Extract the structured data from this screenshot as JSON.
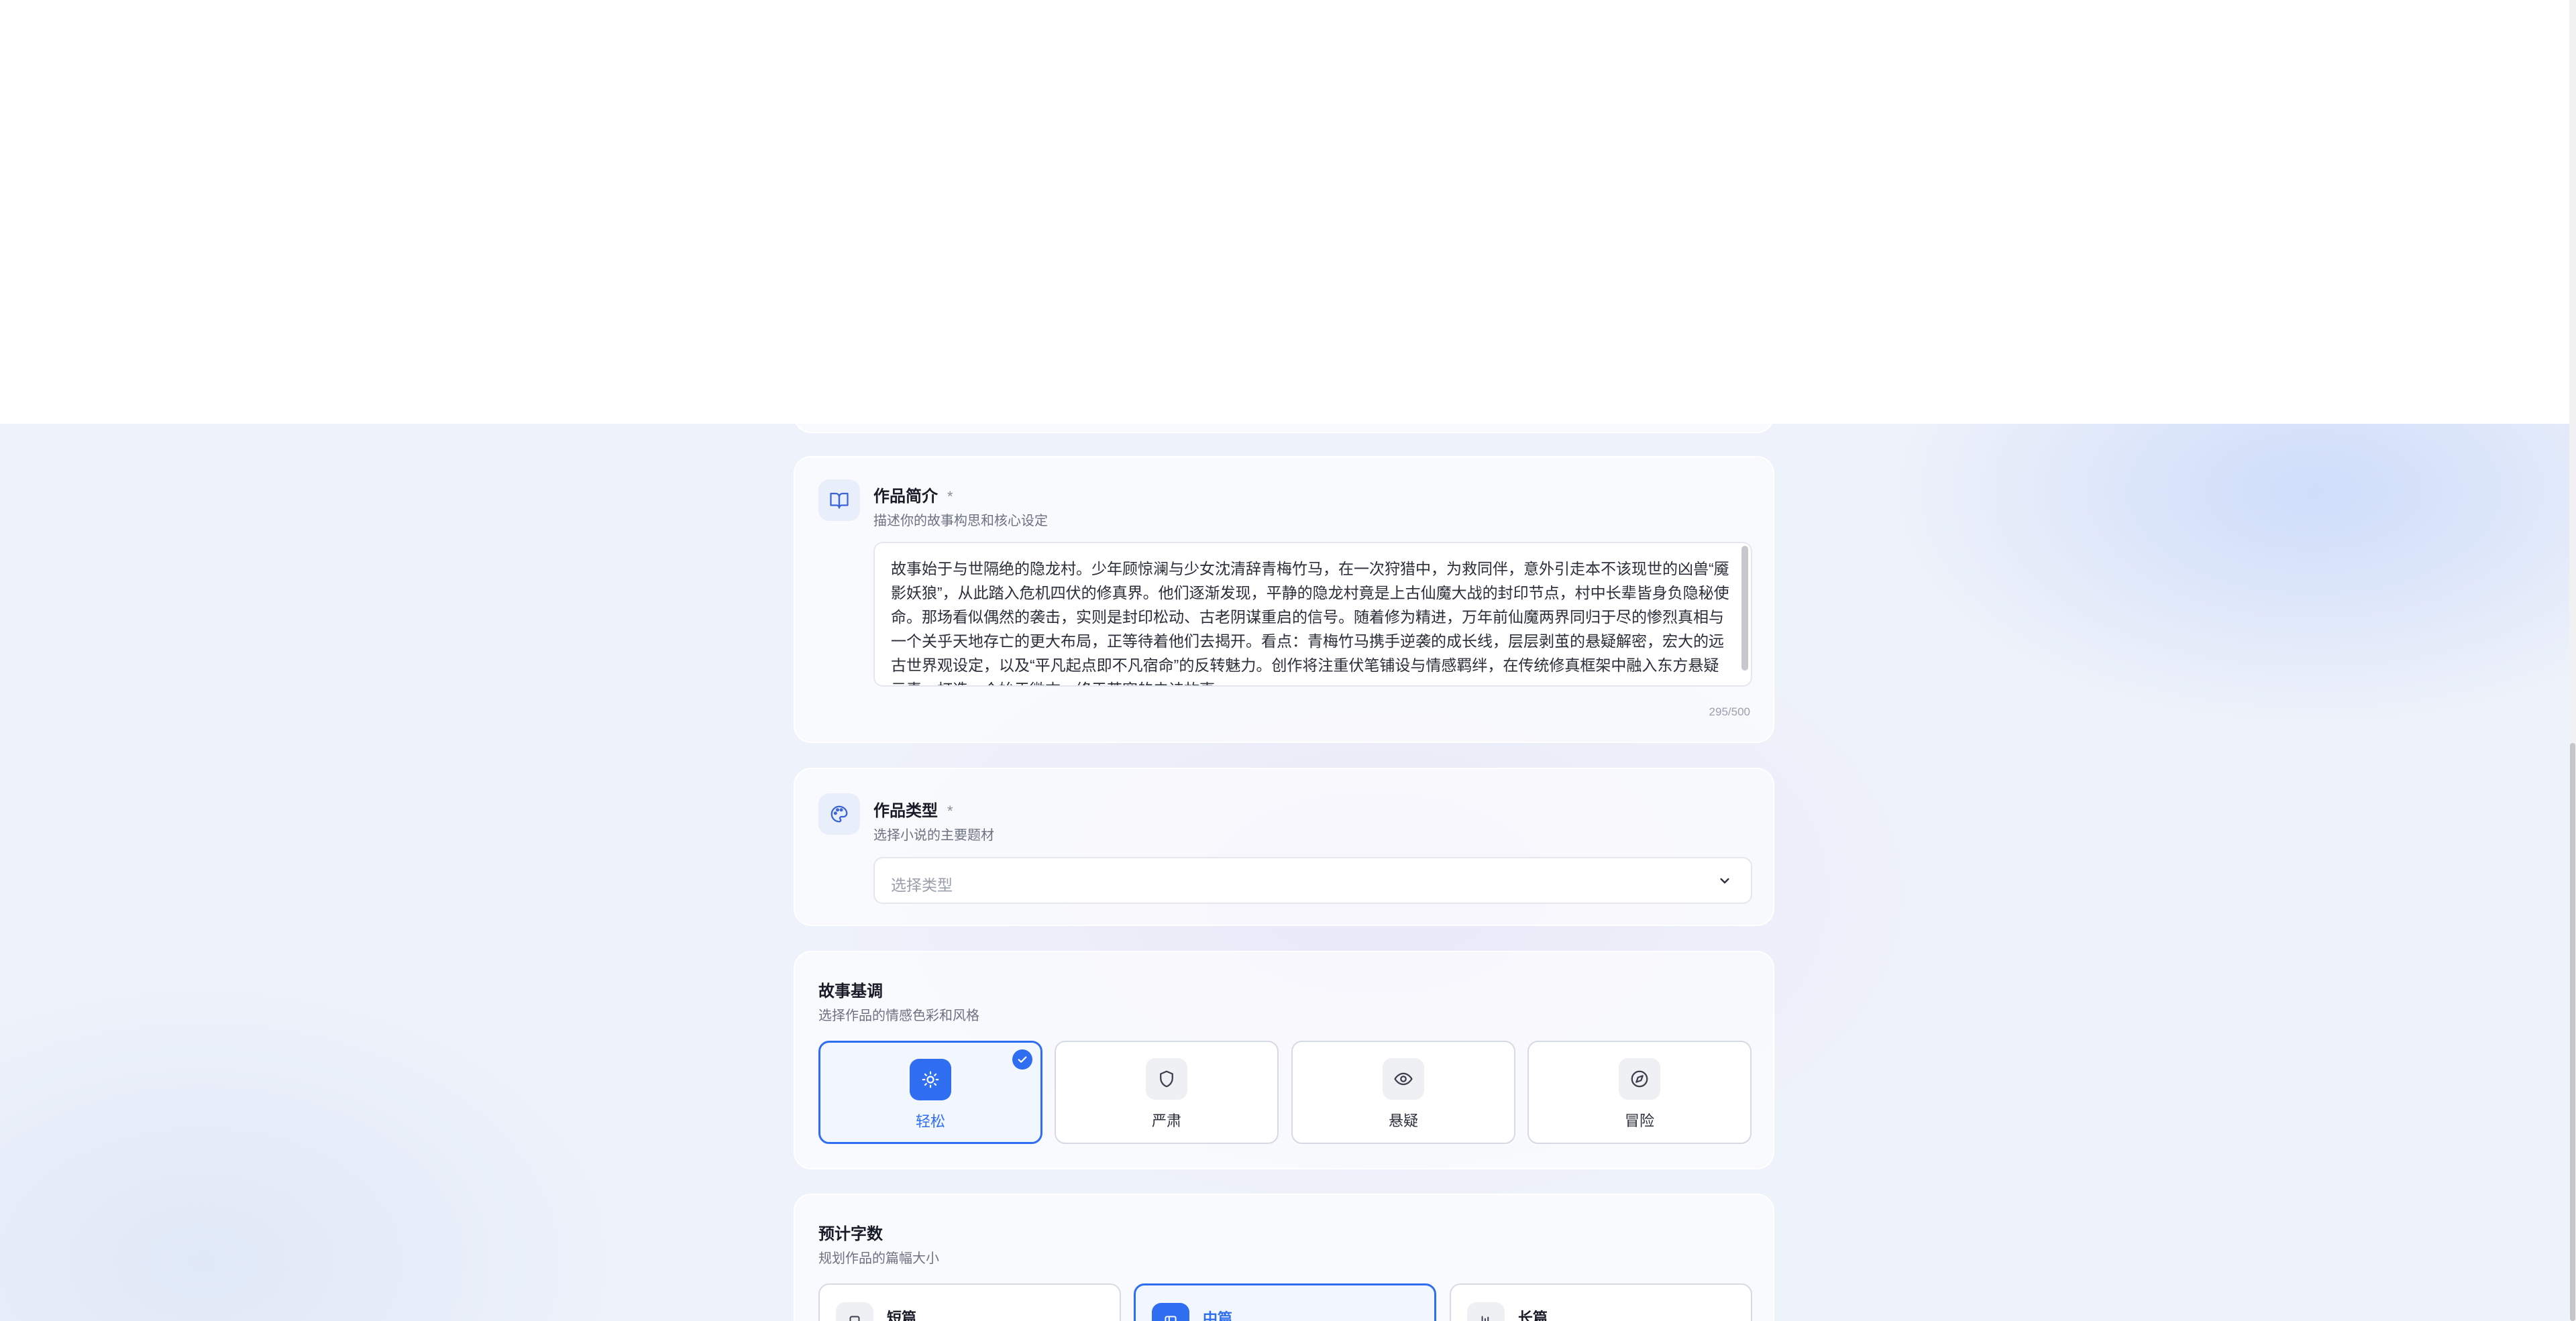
{
  "intro": {
    "label": "作品简介",
    "required_mark": "*",
    "description": "描述你的故事构思和核心设定",
    "icon": "book-open-icon",
    "value": "故事始于与世隔绝的隐龙村。少年顾惊澜与少女沈清辞青梅竹马，在一次狩猎中，为救同伴，意外引走本不该现世的凶兽“魇影妖狼”，从此踏入危机四伏的修真界。他们逐渐发现，平静的隐龙村竟是上古仙魔大战的封印节点，村中长辈皆身负隐秘使命。那场看似偶然的袭击，实则是封印松动、古老阴谋重启的信号。随着修为精进，万年前仙魔两界同归于尽的惨烈真相与一个关乎天地存亡的更大布局，正等待着他们去揭开。看点：青梅竹马携手逆袭的成长线，层层剥茧的悬疑解密，宏大的远古世界观设定，以及“平凡起点即不凡宿命”的反转魅力。创作将注重伏笔铺设与情感羁绊，在传统修真框架中融入东方悬疑元素，打造一个始于微末、终于苍穹的史诗故事。",
    "counter": "295/500"
  },
  "type": {
    "label": "作品类型",
    "required_mark": "*",
    "description": "选择小说的主要题材",
    "icon": "palette-icon",
    "placeholder": "选择类型"
  },
  "tone": {
    "label": "故事基调",
    "description": "选择作品的情感色彩和风格",
    "options": [
      {
        "label": "轻松",
        "icon": "sun-icon",
        "selected": true
      },
      {
        "label": "严肃",
        "icon": "shield-icon",
        "selected": false
      },
      {
        "label": "悬疑",
        "icon": "eye-icon",
        "selected": false
      },
      {
        "label": "冒险",
        "icon": "compass-icon",
        "selected": false
      }
    ]
  },
  "words": {
    "label": "预计字数",
    "description": "规划作品的篇幅大小",
    "options": [
      {
        "label": "短篇",
        "icon": "square-icon",
        "selected": false
      },
      {
        "label": "中篇",
        "icon": "book-icon",
        "selected": true
      },
      {
        "label": "长篇",
        "icon": "library-icon",
        "selected": false
      }
    ]
  },
  "colors": {
    "accent": "#2f6ef0",
    "background": "#eef2fa",
    "card": "#ffffff"
  }
}
